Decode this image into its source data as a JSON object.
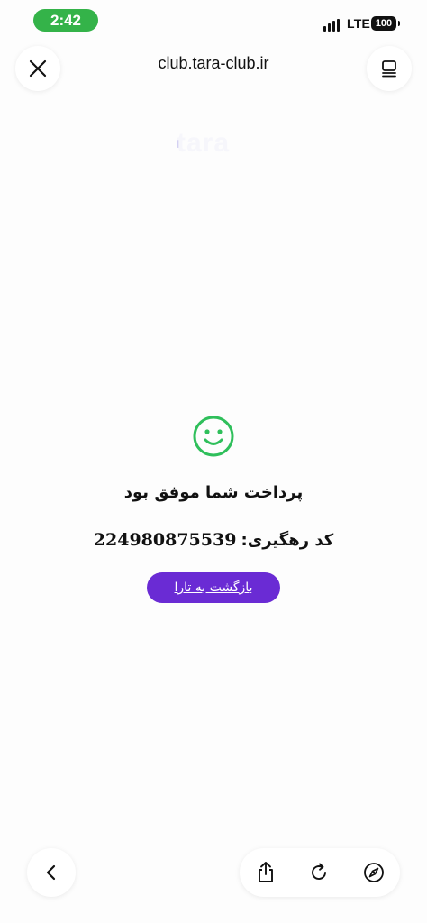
{
  "status_bar": {
    "time": "2:42",
    "network": "LTE",
    "battery": "100",
    "time_pill_color": "#34b349"
  },
  "browser": {
    "url": "club.tara-club.ir",
    "icons": [
      "close-icon",
      "tabs-icon",
      "chevron-left-icon",
      "share-icon",
      "reload-icon",
      "compass-icon"
    ]
  },
  "page": {
    "faint_logo": "tara",
    "success_icon": "smiley-icon",
    "success_color": "#2fbf5b",
    "title": "پرداخت شما موفق بود",
    "tracking_label": "کد رهگیری:",
    "tracking_code": "224980875539",
    "back_button_label": "بازگشت به تارا",
    "accent_color": "#6a2bd4"
  }
}
